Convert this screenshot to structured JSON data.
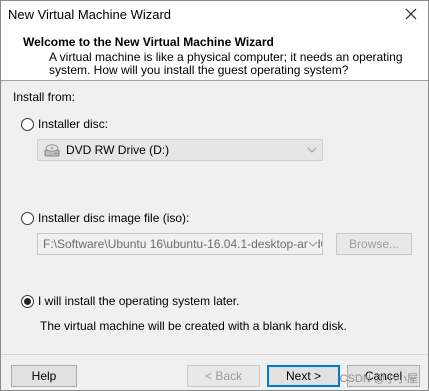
{
  "window": {
    "title": "New Virtual Machine Wizard"
  },
  "header": {
    "title": "Welcome to the New Virtual Machine Wizard",
    "description": "A virtual machine is like a physical computer; it needs an operating system. How will you install the guest operating system?"
  },
  "install": {
    "section_label": "Install from:",
    "options": [
      {
        "label": "Installer disc:",
        "selected": false
      },
      {
        "label": "Installer disc image file (iso):",
        "selected": false
      },
      {
        "label": "I will install the operating system later.",
        "selected": true
      }
    ],
    "disc_drive": {
      "value": "DVD RW Drive (D:)",
      "icon": "dvd-drive-icon"
    },
    "iso_path": {
      "value": "F:\\Software\\Ubuntu 16\\ubuntu-16.04.1-desktop-amd6"
    },
    "browse_label": "Browse...",
    "later_description": "The virtual machine will be created with a blank hard disk."
  },
  "footer": {
    "help": "Help",
    "back": "< Back",
    "next": "Next >",
    "cancel": "Cancel"
  },
  "watermark": "CSDN @小小屋"
}
